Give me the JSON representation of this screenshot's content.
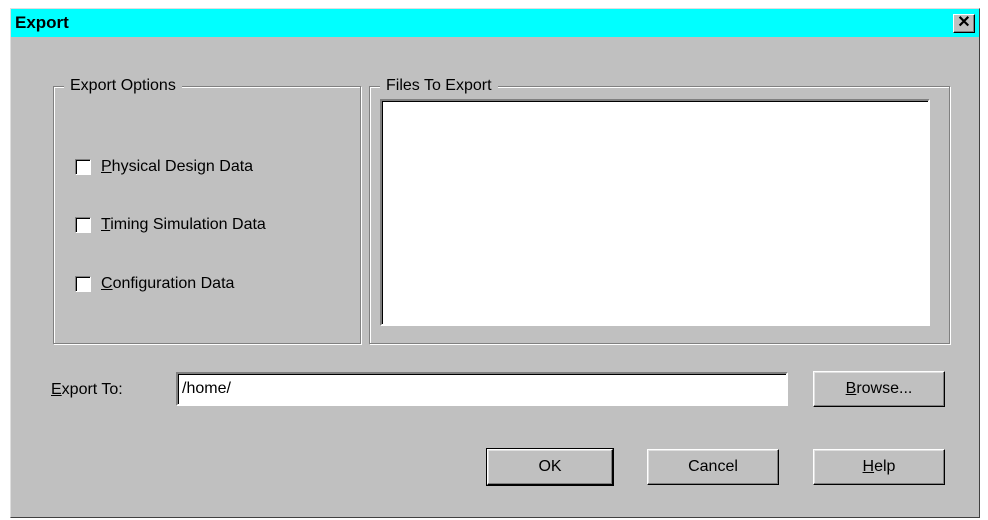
{
  "window": {
    "title": "Export",
    "close_glyph": "✕"
  },
  "export_options": {
    "legend": "Export Options",
    "items": [
      {
        "mnemonic": "P",
        "rest": "hysical Design Data",
        "checked": false
      },
      {
        "mnemonic": "T",
        "rest": "iming Simulation Data",
        "checked": false
      },
      {
        "mnemonic": "C",
        "rest": "onfiguration Data",
        "checked": false
      }
    ]
  },
  "files_to_export": {
    "legend": "Files To Export"
  },
  "export_to": {
    "label_mnemonic": "E",
    "label_rest": "xport To:",
    "value": "/home/"
  },
  "buttons": {
    "browse_mnemonic": "B",
    "browse_rest": "rowse...",
    "ok": "OK",
    "cancel": "Cancel",
    "help_mnemonic": "H",
    "help_rest": "elp"
  }
}
